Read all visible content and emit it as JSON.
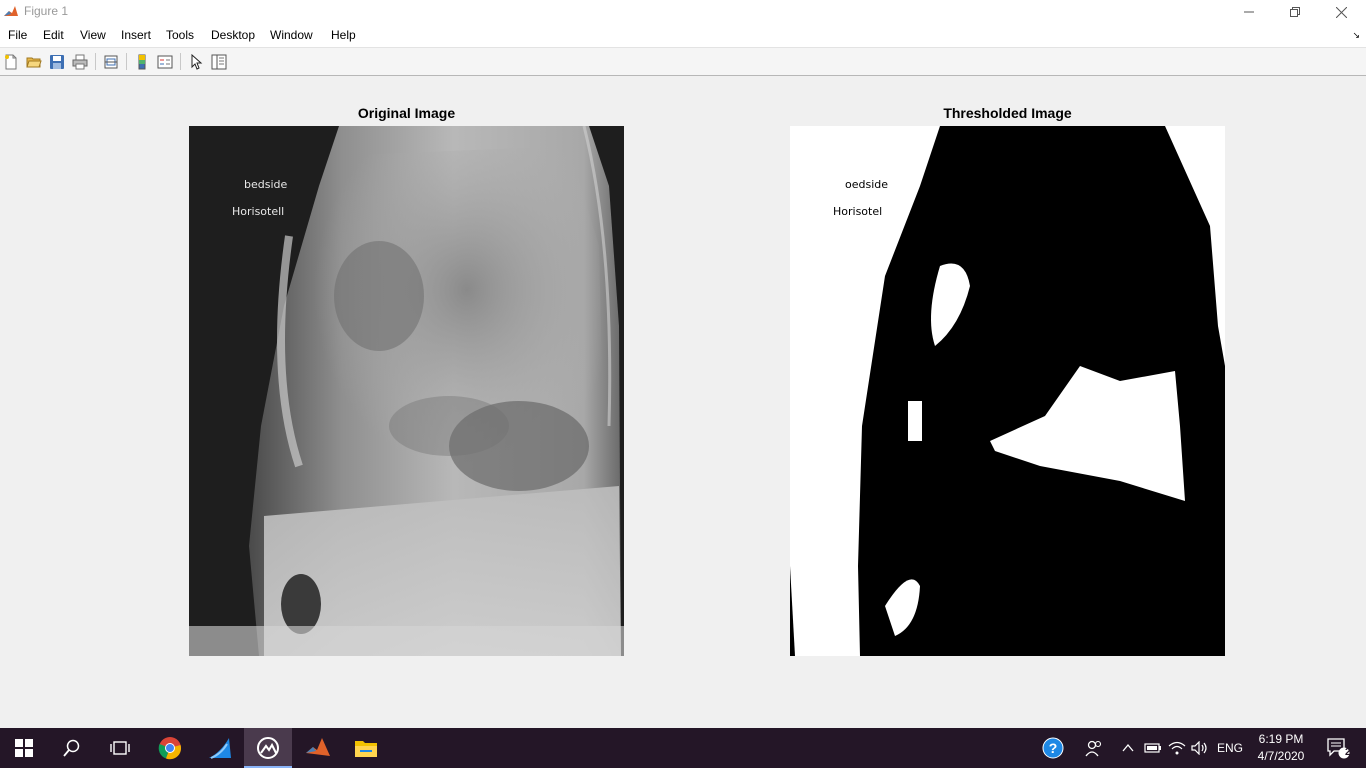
{
  "window": {
    "title": "Figure 1",
    "controls": [
      "minimize",
      "restore",
      "close"
    ]
  },
  "menubar": {
    "items": [
      "File",
      "Edit",
      "View",
      "Insert",
      "Tools",
      "Desktop",
      "Window",
      "Help"
    ],
    "dock_glyph": "↘"
  },
  "toolbar": {
    "buttons": [
      "new-figure-icon",
      "open-file-icon",
      "save-icon",
      "print-icon",
      "link-plot-icon",
      "insert-colorbar-icon",
      "insert-legend-icon",
      "edit-plot-arrow-icon",
      "property-inspector-icon"
    ]
  },
  "figure": {
    "left_axes": {
      "title": "Original Image",
      "overlay_text": [
        "bedside",
        "Horisotell"
      ]
    },
    "right_axes": {
      "title": "Thresholded Image",
      "overlay_text": [
        "oedside",
        "Horisotel"
      ]
    }
  },
  "taskbar": {
    "apps": [
      "windows-start-icon",
      "search-icon",
      "task-view-icon",
      "chrome-icon",
      "shark-app-icon",
      "matlab-figure-icon",
      "matlab-icon",
      "file-explorer-icon"
    ],
    "active_app": "matlab-figure-icon",
    "tray": {
      "language": "ENG",
      "time": "6:19 PM",
      "date": "4/7/2020",
      "notification_count": "2"
    }
  },
  "colors": {
    "taskbar_bg": "#241627",
    "figure_bg": "#f0f0f0",
    "help_icon_bg": "#1e88e5"
  }
}
